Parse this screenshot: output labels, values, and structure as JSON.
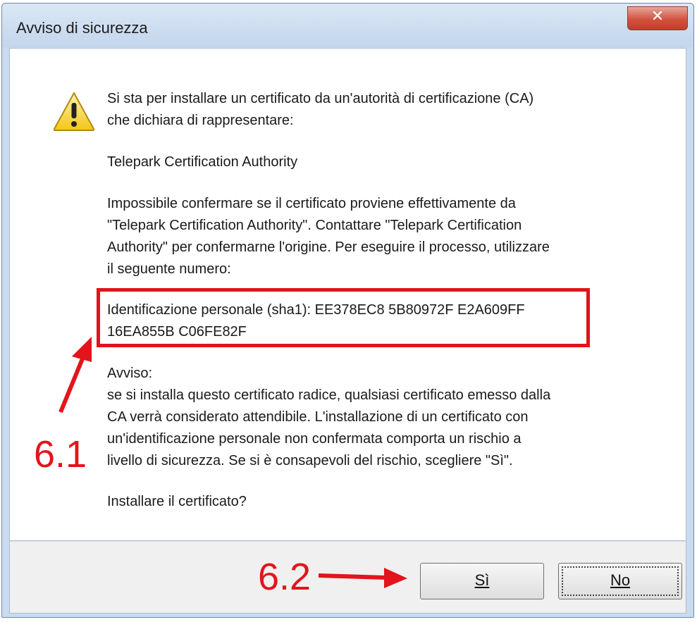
{
  "window": {
    "title": "Avviso di sicurezza",
    "close_glyph": "✕"
  },
  "message": {
    "line1": "Si sta per installare un certificato da un'autorità di certificazione (CA)",
    "line2": "che dichiara di rappresentare:",
    "ca_name": "Telepark Certification Authority",
    "p2_l1": "Impossibile confermare se il certificato proviene effettivamente da",
    "p2_l2": "\"Telepark Certification Authority\". Contattare \"Telepark Certification",
    "p2_l3": "Authority\" per confermarne l'origine. Per eseguire il processo, utilizzare",
    "p2_l4": "il seguente numero:",
    "thumb_l1": "Identificazione personale (sha1): EE378EC8 5B80972F E2A609FF",
    "thumb_l2": "16EA855B C06FE82F",
    "warn_title": "Avviso:",
    "warn_l1": "se si installa questo certificato radice, qualsiasi certificato emesso dalla",
    "warn_l2": "CA verrà considerato attendibile. L'installazione di un certificato con",
    "warn_l3": "un'identificazione personale non confermata comporta un rischio a",
    "warn_l4": "livello di sicurezza. Se si è consapevoli del rischio, scegliere \"Sì\".",
    "question": "Installare il certificato?"
  },
  "buttons": {
    "yes": "Sì",
    "no": "No"
  },
  "annotations": {
    "step1": "6.1",
    "step2": "6.2",
    "color": "#e3141b"
  },
  "icons": {
    "warning": "warning-icon"
  }
}
